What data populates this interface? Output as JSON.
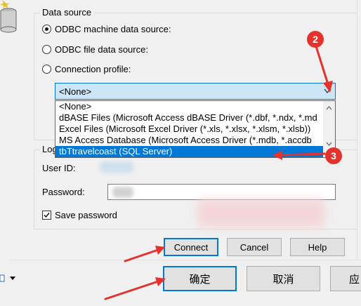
{
  "data_source": {
    "legend": "Data source",
    "options": [
      {
        "label": "ODBC machine data source:",
        "checked": true
      },
      {
        "label": "ODBC file data source:",
        "checked": false
      },
      {
        "label": "Connection profile:",
        "checked": false
      }
    ],
    "combo_value": "<None>",
    "dropdown_items": [
      "<None>",
      "dBASE Files (Microsoft Access dBASE Driver (*.dbf, *.ndx, *.md",
      "Excel Files (Microsoft Excel Driver (*.xls, *.xlsx, *.xlsm, *.xlsb))",
      "MS Access Database (Microsoft Access Driver (*.mdb, *.accdb",
      "tbTtravelcoast (SQL Server)"
    ],
    "selected_index": 4
  },
  "login": {
    "legend": "Log",
    "user_id_label": "User ID:",
    "password_label": "Password:",
    "save_password_label": "Save password",
    "save_password_checked": true
  },
  "buttons": {
    "connect": "Connect",
    "cancel": "Cancel",
    "help": "Help"
  },
  "bottom_buttons": {
    "ok": "确定",
    "cancel": "取消",
    "apply": "应"
  },
  "annotations": {
    "marker_2": "2",
    "marker_3": "3",
    "accent_color": "#e5322d"
  },
  "colors": {
    "selection": "#0078d7",
    "background": "#f0f0f0"
  }
}
